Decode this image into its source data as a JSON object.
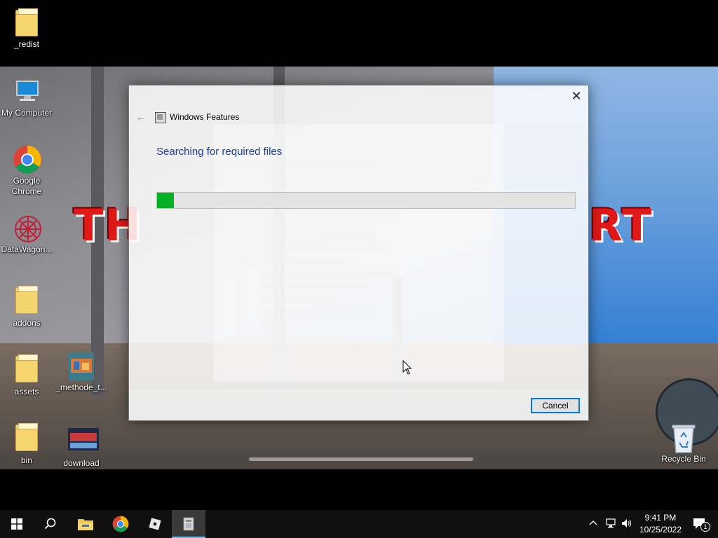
{
  "desktop": {
    "icons": [
      {
        "label": "_redist",
        "icon": "folder-icon"
      },
      {
        "label": "My Computer",
        "icon": "computer-icon"
      },
      {
        "label": "Google\nChrome",
        "icon": "chrome-icon"
      },
      {
        "label": "DataWagon...",
        "icon": "datawagon-icon"
      },
      {
        "label": "addons",
        "icon": "folder-icon"
      },
      {
        "label": "assets",
        "icon": "folder-icon"
      },
      {
        "label": "_methode_t...",
        "icon": "image-icon"
      },
      {
        "label": "bin",
        "icon": "folder-icon"
      },
      {
        "label": "download",
        "icon": "image-icon"
      },
      {
        "label": "Recycle Bin",
        "icon": "recycle-bin-icon"
      }
    ]
  },
  "dialog": {
    "title": "Windows Features",
    "heading": "Searching for required files",
    "progress_percent": 4,
    "cancel_label": "Cancel",
    "close_glyph": "✕",
    "back_glyph": "←"
  },
  "taskbar": {
    "start_icon": "windows-start-icon",
    "pinned": [
      "search-icon",
      "file-explorer-icon",
      "chrome-icon",
      "roblox-icon",
      "windows-features-icon"
    ],
    "time": "9:41 PM",
    "date": "10/25/2022",
    "notification_count": "1"
  },
  "colors": {
    "heading": "#1d3f8f",
    "progress": "#06b025",
    "focus_border": "#0078d7",
    "taskbar": "#101010"
  }
}
